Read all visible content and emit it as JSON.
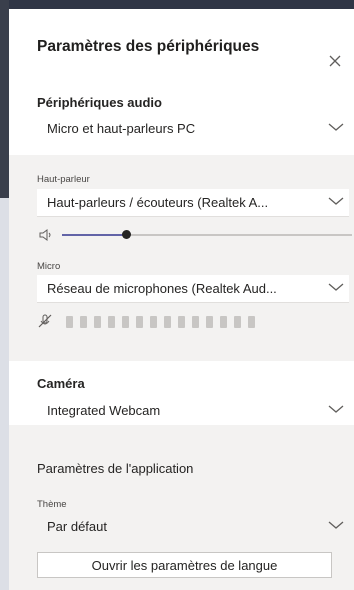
{
  "title": "Paramètres des périphériques",
  "close_label": "×",
  "audio": {
    "heading": "Périphériques audio",
    "device": "Micro et haut-parleurs PC"
  },
  "speaker": {
    "label": "Haut-parleur",
    "device": "Haut-parleurs / écouteurs (Realtek A...",
    "volume_percent": 22
  },
  "mic": {
    "label": "Micro",
    "device": "Réseau de microphones (Realtek Aud...",
    "level_bars": 14,
    "muted": true
  },
  "camera": {
    "heading": "Caméra",
    "device": "Integrated Webcam"
  },
  "app_settings": {
    "heading": "Paramètres de l'application",
    "theme_label": "Thème",
    "theme_value": "Par défaut",
    "language_button": "Ouvrir les paramètres de langue"
  },
  "icons": {
    "close": "close-icon",
    "chevron": "chevron-down-icon",
    "speaker": "speaker-icon",
    "mic_muted": "mic-off-icon"
  },
  "colors": {
    "panel_bg": "#f3f2f1",
    "accent": "#6264a7",
    "dark_edge": "#2f3545"
  }
}
